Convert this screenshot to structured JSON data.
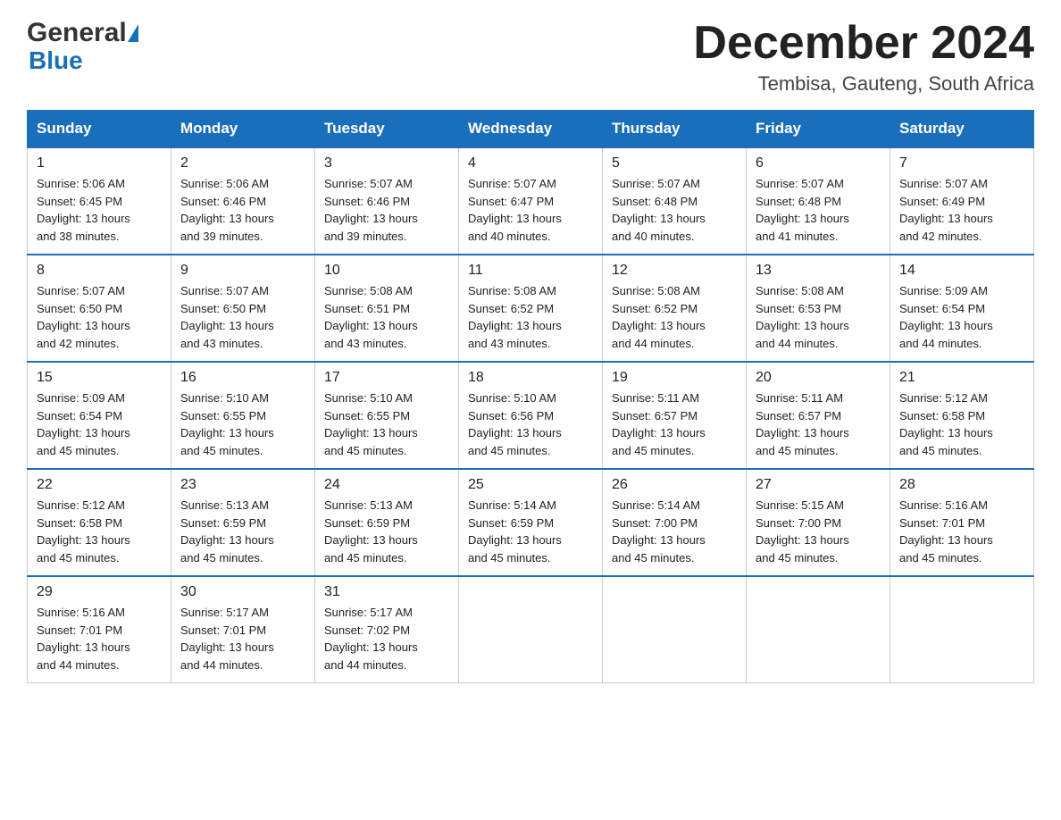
{
  "header": {
    "logo_general": "General",
    "logo_blue": "Blue",
    "month_title": "December 2024",
    "location": "Tembisa, Gauteng, South Africa"
  },
  "weekdays": [
    "Sunday",
    "Monday",
    "Tuesday",
    "Wednesday",
    "Thursday",
    "Friday",
    "Saturday"
  ],
  "rows": [
    [
      {
        "day": "1",
        "sunrise": "5:06 AM",
        "sunset": "6:45 PM",
        "daylight": "13 hours and 38 minutes."
      },
      {
        "day": "2",
        "sunrise": "5:06 AM",
        "sunset": "6:46 PM",
        "daylight": "13 hours and 39 minutes."
      },
      {
        "day": "3",
        "sunrise": "5:07 AM",
        "sunset": "6:46 PM",
        "daylight": "13 hours and 39 minutes."
      },
      {
        "day": "4",
        "sunrise": "5:07 AM",
        "sunset": "6:47 PM",
        "daylight": "13 hours and 40 minutes."
      },
      {
        "day": "5",
        "sunrise": "5:07 AM",
        "sunset": "6:48 PM",
        "daylight": "13 hours and 40 minutes."
      },
      {
        "day": "6",
        "sunrise": "5:07 AM",
        "sunset": "6:48 PM",
        "daylight": "13 hours and 41 minutes."
      },
      {
        "day": "7",
        "sunrise": "5:07 AM",
        "sunset": "6:49 PM",
        "daylight": "13 hours and 42 minutes."
      }
    ],
    [
      {
        "day": "8",
        "sunrise": "5:07 AM",
        "sunset": "6:50 PM",
        "daylight": "13 hours and 42 minutes."
      },
      {
        "day": "9",
        "sunrise": "5:07 AM",
        "sunset": "6:50 PM",
        "daylight": "13 hours and 43 minutes."
      },
      {
        "day": "10",
        "sunrise": "5:08 AM",
        "sunset": "6:51 PM",
        "daylight": "13 hours and 43 minutes."
      },
      {
        "day": "11",
        "sunrise": "5:08 AM",
        "sunset": "6:52 PM",
        "daylight": "13 hours and 43 minutes."
      },
      {
        "day": "12",
        "sunrise": "5:08 AM",
        "sunset": "6:52 PM",
        "daylight": "13 hours and 44 minutes."
      },
      {
        "day": "13",
        "sunrise": "5:08 AM",
        "sunset": "6:53 PM",
        "daylight": "13 hours and 44 minutes."
      },
      {
        "day": "14",
        "sunrise": "5:09 AM",
        "sunset": "6:54 PM",
        "daylight": "13 hours and 44 minutes."
      }
    ],
    [
      {
        "day": "15",
        "sunrise": "5:09 AM",
        "sunset": "6:54 PM",
        "daylight": "13 hours and 45 minutes."
      },
      {
        "day": "16",
        "sunrise": "5:10 AM",
        "sunset": "6:55 PM",
        "daylight": "13 hours and 45 minutes."
      },
      {
        "day": "17",
        "sunrise": "5:10 AM",
        "sunset": "6:55 PM",
        "daylight": "13 hours and 45 minutes."
      },
      {
        "day": "18",
        "sunrise": "5:10 AM",
        "sunset": "6:56 PM",
        "daylight": "13 hours and 45 minutes."
      },
      {
        "day": "19",
        "sunrise": "5:11 AM",
        "sunset": "6:57 PM",
        "daylight": "13 hours and 45 minutes."
      },
      {
        "day": "20",
        "sunrise": "5:11 AM",
        "sunset": "6:57 PM",
        "daylight": "13 hours and 45 minutes."
      },
      {
        "day": "21",
        "sunrise": "5:12 AM",
        "sunset": "6:58 PM",
        "daylight": "13 hours and 45 minutes."
      }
    ],
    [
      {
        "day": "22",
        "sunrise": "5:12 AM",
        "sunset": "6:58 PM",
        "daylight": "13 hours and 45 minutes."
      },
      {
        "day": "23",
        "sunrise": "5:13 AM",
        "sunset": "6:59 PM",
        "daylight": "13 hours and 45 minutes."
      },
      {
        "day": "24",
        "sunrise": "5:13 AM",
        "sunset": "6:59 PM",
        "daylight": "13 hours and 45 minutes."
      },
      {
        "day": "25",
        "sunrise": "5:14 AM",
        "sunset": "6:59 PM",
        "daylight": "13 hours and 45 minutes."
      },
      {
        "day": "26",
        "sunrise": "5:14 AM",
        "sunset": "7:00 PM",
        "daylight": "13 hours and 45 minutes."
      },
      {
        "day": "27",
        "sunrise": "5:15 AM",
        "sunset": "7:00 PM",
        "daylight": "13 hours and 45 minutes."
      },
      {
        "day": "28",
        "sunrise": "5:16 AM",
        "sunset": "7:01 PM",
        "daylight": "13 hours and 45 minutes."
      }
    ],
    [
      {
        "day": "29",
        "sunrise": "5:16 AM",
        "sunset": "7:01 PM",
        "daylight": "13 hours and 44 minutes."
      },
      {
        "day": "30",
        "sunrise": "5:17 AM",
        "sunset": "7:01 PM",
        "daylight": "13 hours and 44 minutes."
      },
      {
        "day": "31",
        "sunrise": "5:17 AM",
        "sunset": "7:02 PM",
        "daylight": "13 hours and 44 minutes."
      },
      null,
      null,
      null,
      null
    ]
  ],
  "labels": {
    "sunrise": "Sunrise:",
    "sunset": "Sunset:",
    "daylight": "Daylight:"
  },
  "colors": {
    "header_bg": "#1a6fba",
    "header_text": "#ffffff",
    "border_top": "#1a6fba"
  }
}
